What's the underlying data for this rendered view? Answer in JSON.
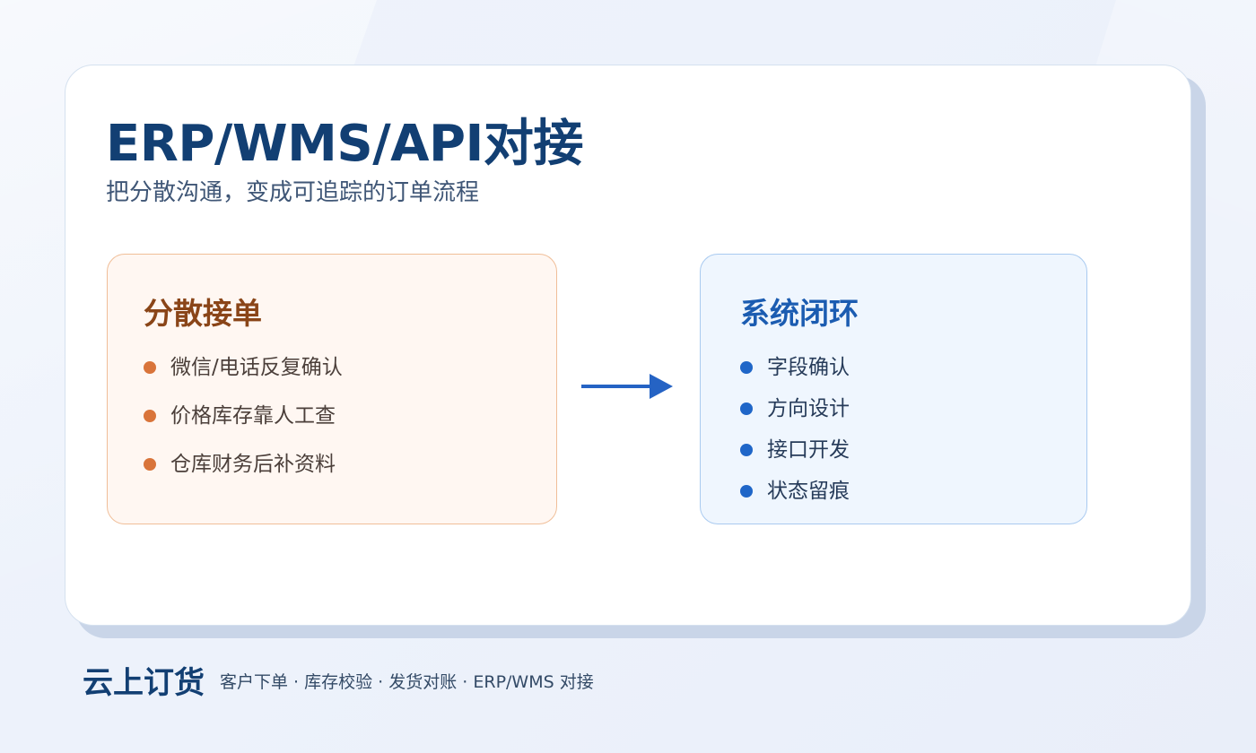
{
  "slide": {
    "title": "ERP/WMS/API对接",
    "subtitle": "把分散沟通，变成可追踪的订单流程"
  },
  "left_panel": {
    "heading": "分散接单",
    "accent_color": "#d9743a",
    "items": [
      "微信/电话反复确认",
      "价格库存靠人工查",
      "仓库财务后补资料"
    ]
  },
  "right_panel": {
    "heading": "系统闭环",
    "accent_color": "#1f66c8",
    "items": [
      "字段确认",
      "方向设计",
      "接口开发",
      "状态留痕"
    ]
  },
  "connector": {
    "icon": "arrow-right-icon",
    "color": "#2563c4"
  },
  "footer": {
    "brand": "云上订货",
    "tagline": "客户下单 · 库存校验 · 发货对账 · ERP/WMS 对接"
  },
  "colors": {
    "title": "#123f73",
    "card_background": "#ffffff",
    "page_background": "#edf2fb"
  }
}
